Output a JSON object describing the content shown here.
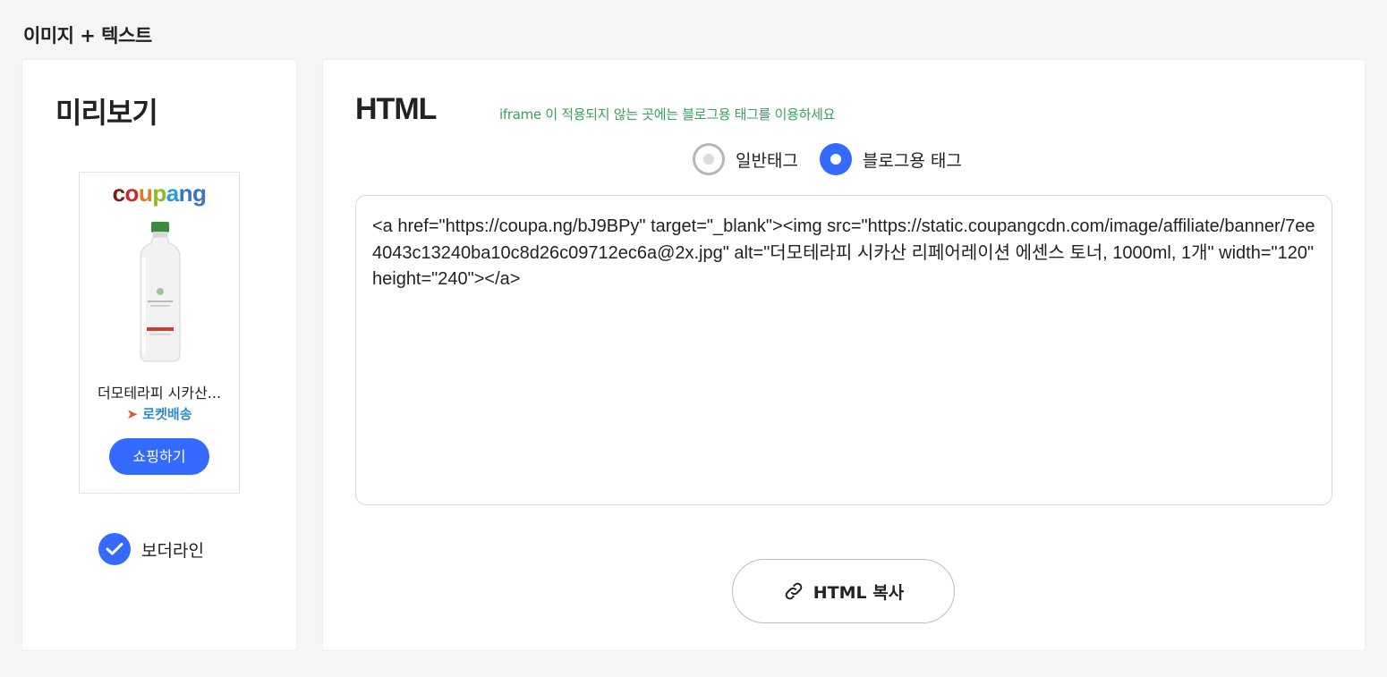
{
  "section": {
    "title": "이미지 + 텍스트"
  },
  "preview": {
    "heading": "미리보기",
    "banner": {
      "logo_parts": [
        "c",
        "o",
        "u",
        "p",
        "a",
        "ng"
      ],
      "product_name": "더모테라피 시카산...",
      "rocket_label": "로켓배송",
      "shop_button": "쇼핑하기"
    },
    "border_option": {
      "label": "보더라인",
      "checked": true
    }
  },
  "html_panel": {
    "heading": "HTML",
    "notice": "iframe 이 적용되지 않는 곳에는 블로그용 태그를 이용하세요",
    "radios": [
      {
        "label": "일반태그",
        "selected": false
      },
      {
        "label": "블로그용 태그",
        "selected": true
      }
    ],
    "code": "<a href=\"https://coupa.ng/bJ9BPy\" target=\"_blank\"><img src=\"https://static.coupangcdn.com/image/affiliate/banner/7ee4043c13240ba10c8d26c09712ec6a@2x.jpg\" alt=\"더모테라피 시카산 리페어레이션 에센스 토너, 1000ml, 1개\" width=\"120\" height=\"240\"></a>",
    "copy_button": "HTML 복사"
  },
  "colors": {
    "accent": "#346aff",
    "notice": "#35a35b",
    "rocket": "#2b8ccf"
  },
  "icons": [
    "rocket-icon",
    "check-icon",
    "link-icon"
  ]
}
